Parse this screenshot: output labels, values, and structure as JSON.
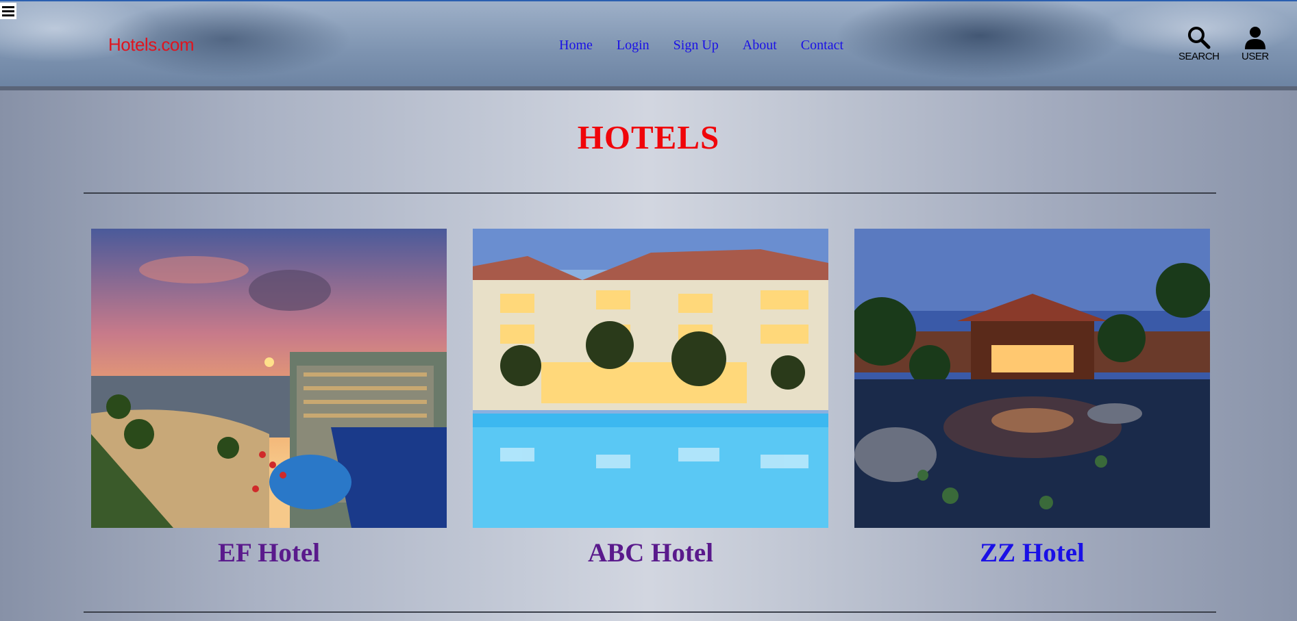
{
  "header": {
    "logo": "Hotels.com",
    "nav": [
      "Home",
      "Login",
      "Sign Up",
      "About",
      "Contact"
    ],
    "search_label": "SEARCH",
    "user_label": "USER"
  },
  "main": {
    "title": "HOTELS",
    "hotels": [
      {
        "name": "EF Hotel",
        "color": "#5a1a8c"
      },
      {
        "name": "ABC Hotel",
        "color": "#5a1a8c"
      },
      {
        "name": "ZZ Hotel",
        "color": "#1a10e6"
      }
    ]
  },
  "colors": {
    "title": "#f0050a",
    "logo": "#e0141e",
    "nav_link": "#1a10e6"
  }
}
